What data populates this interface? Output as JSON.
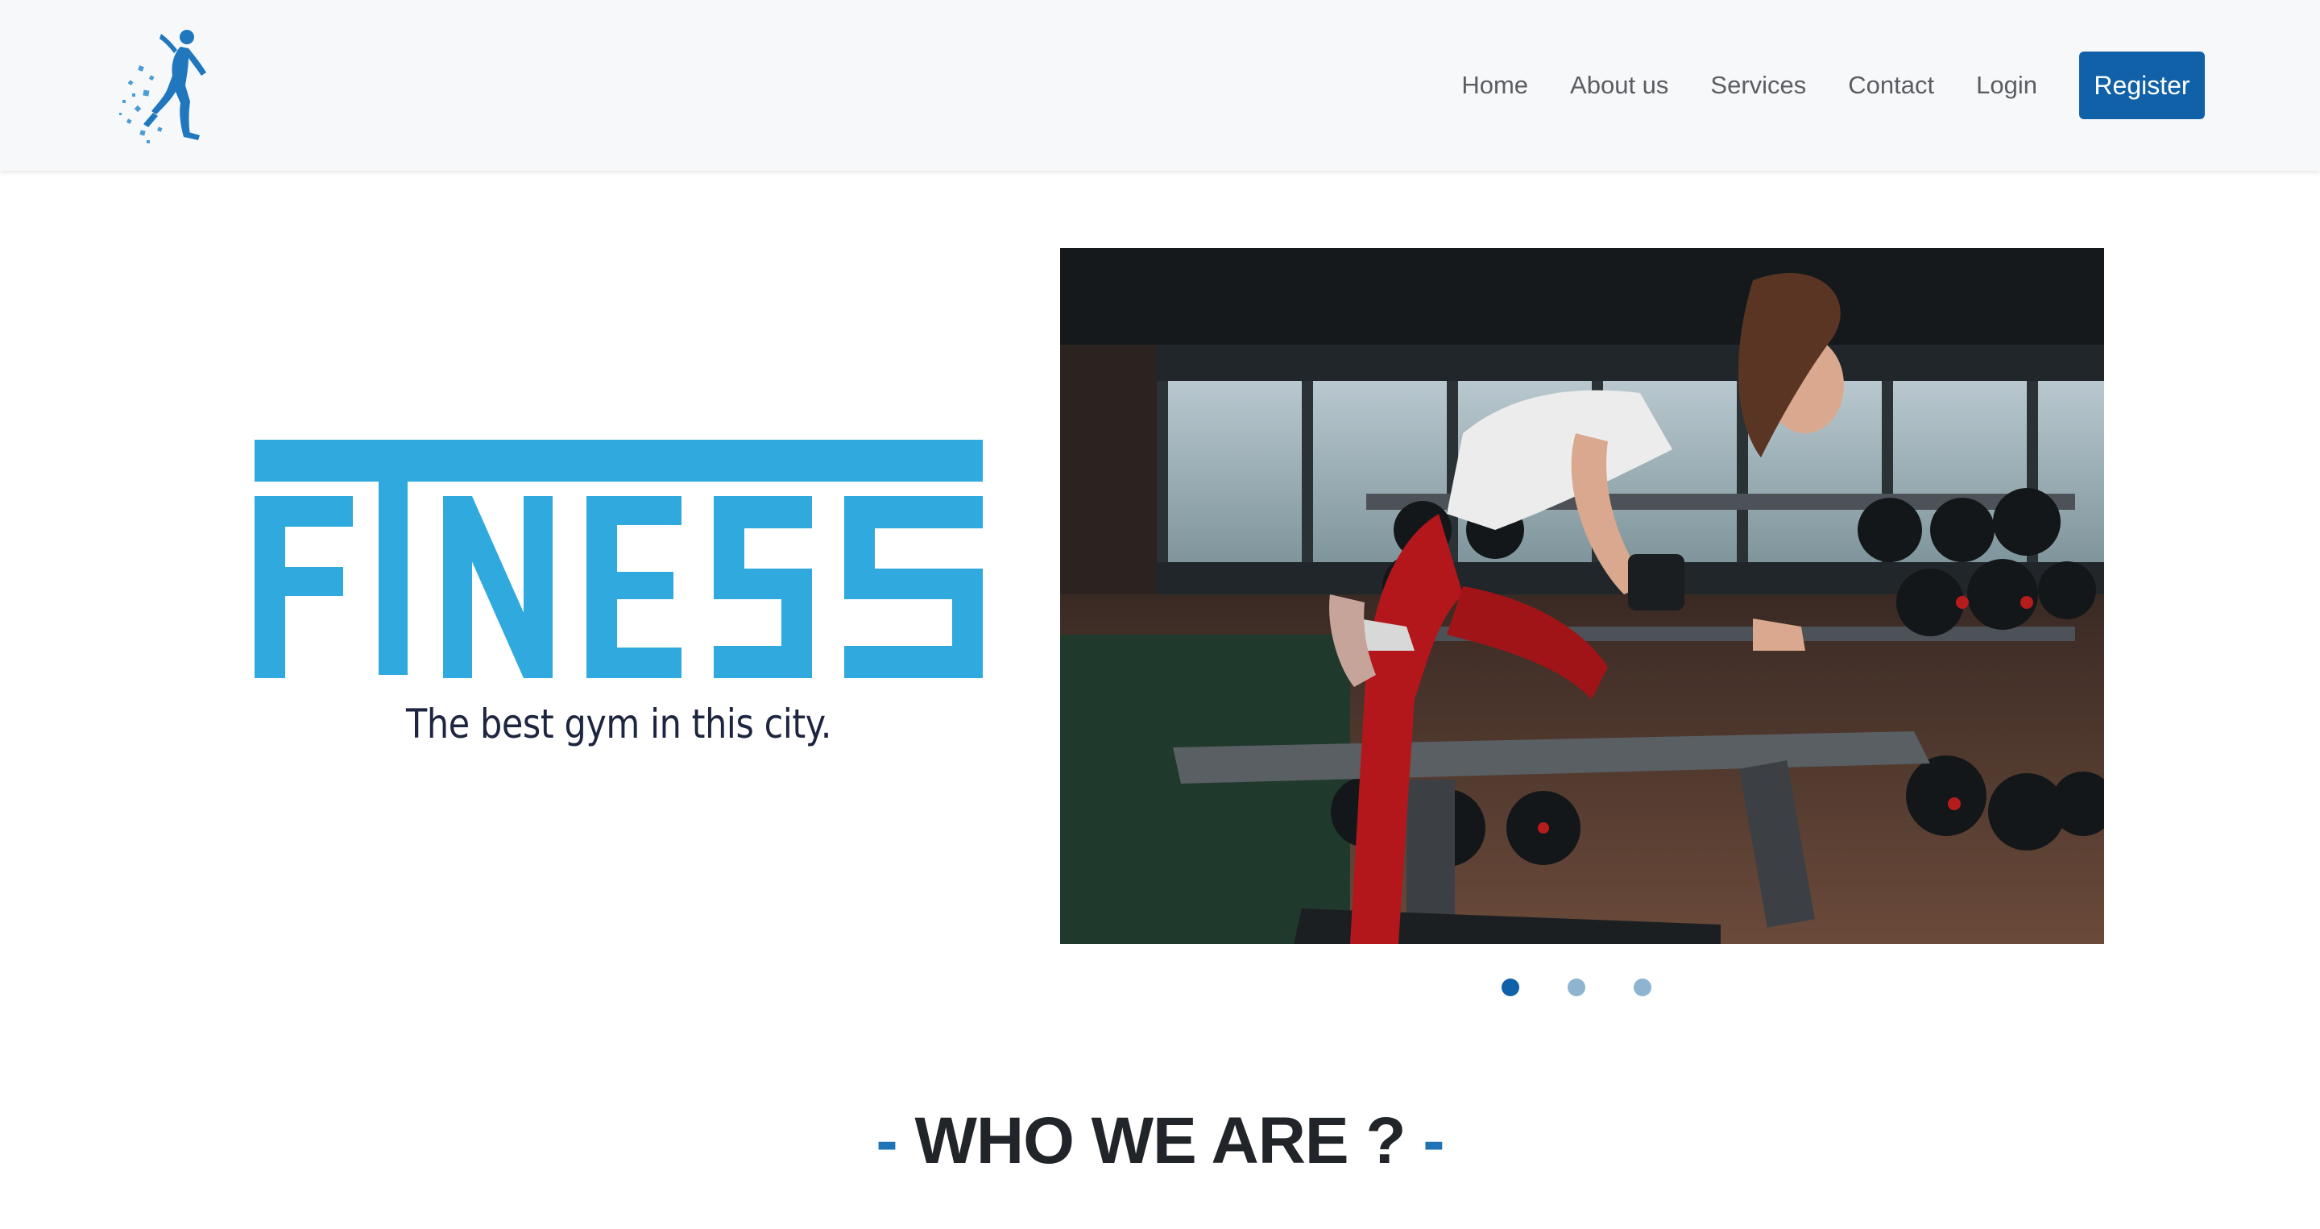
{
  "nav": {
    "logo_icon": "runner-logo-icon",
    "links": [
      "Home",
      "About us",
      "Services",
      "Contact",
      "Login"
    ],
    "register_label": "Register"
  },
  "hero": {
    "brand": "FITNESS",
    "tagline": "The best gym in this city."
  },
  "carousel": {
    "slides": 3,
    "active_index": 0,
    "image_icon": "woman-dumbbell-row-photo"
  },
  "section": {
    "dash_left": "-",
    "title": "WHO WE ARE ?",
    "dash_right": "-"
  },
  "colors": {
    "accent": "#1161a8",
    "brand_blue": "#2fa9de",
    "dot_active": "#1161a8",
    "dot_inactive": "#8db4d0",
    "text_dark": "#212428"
  }
}
